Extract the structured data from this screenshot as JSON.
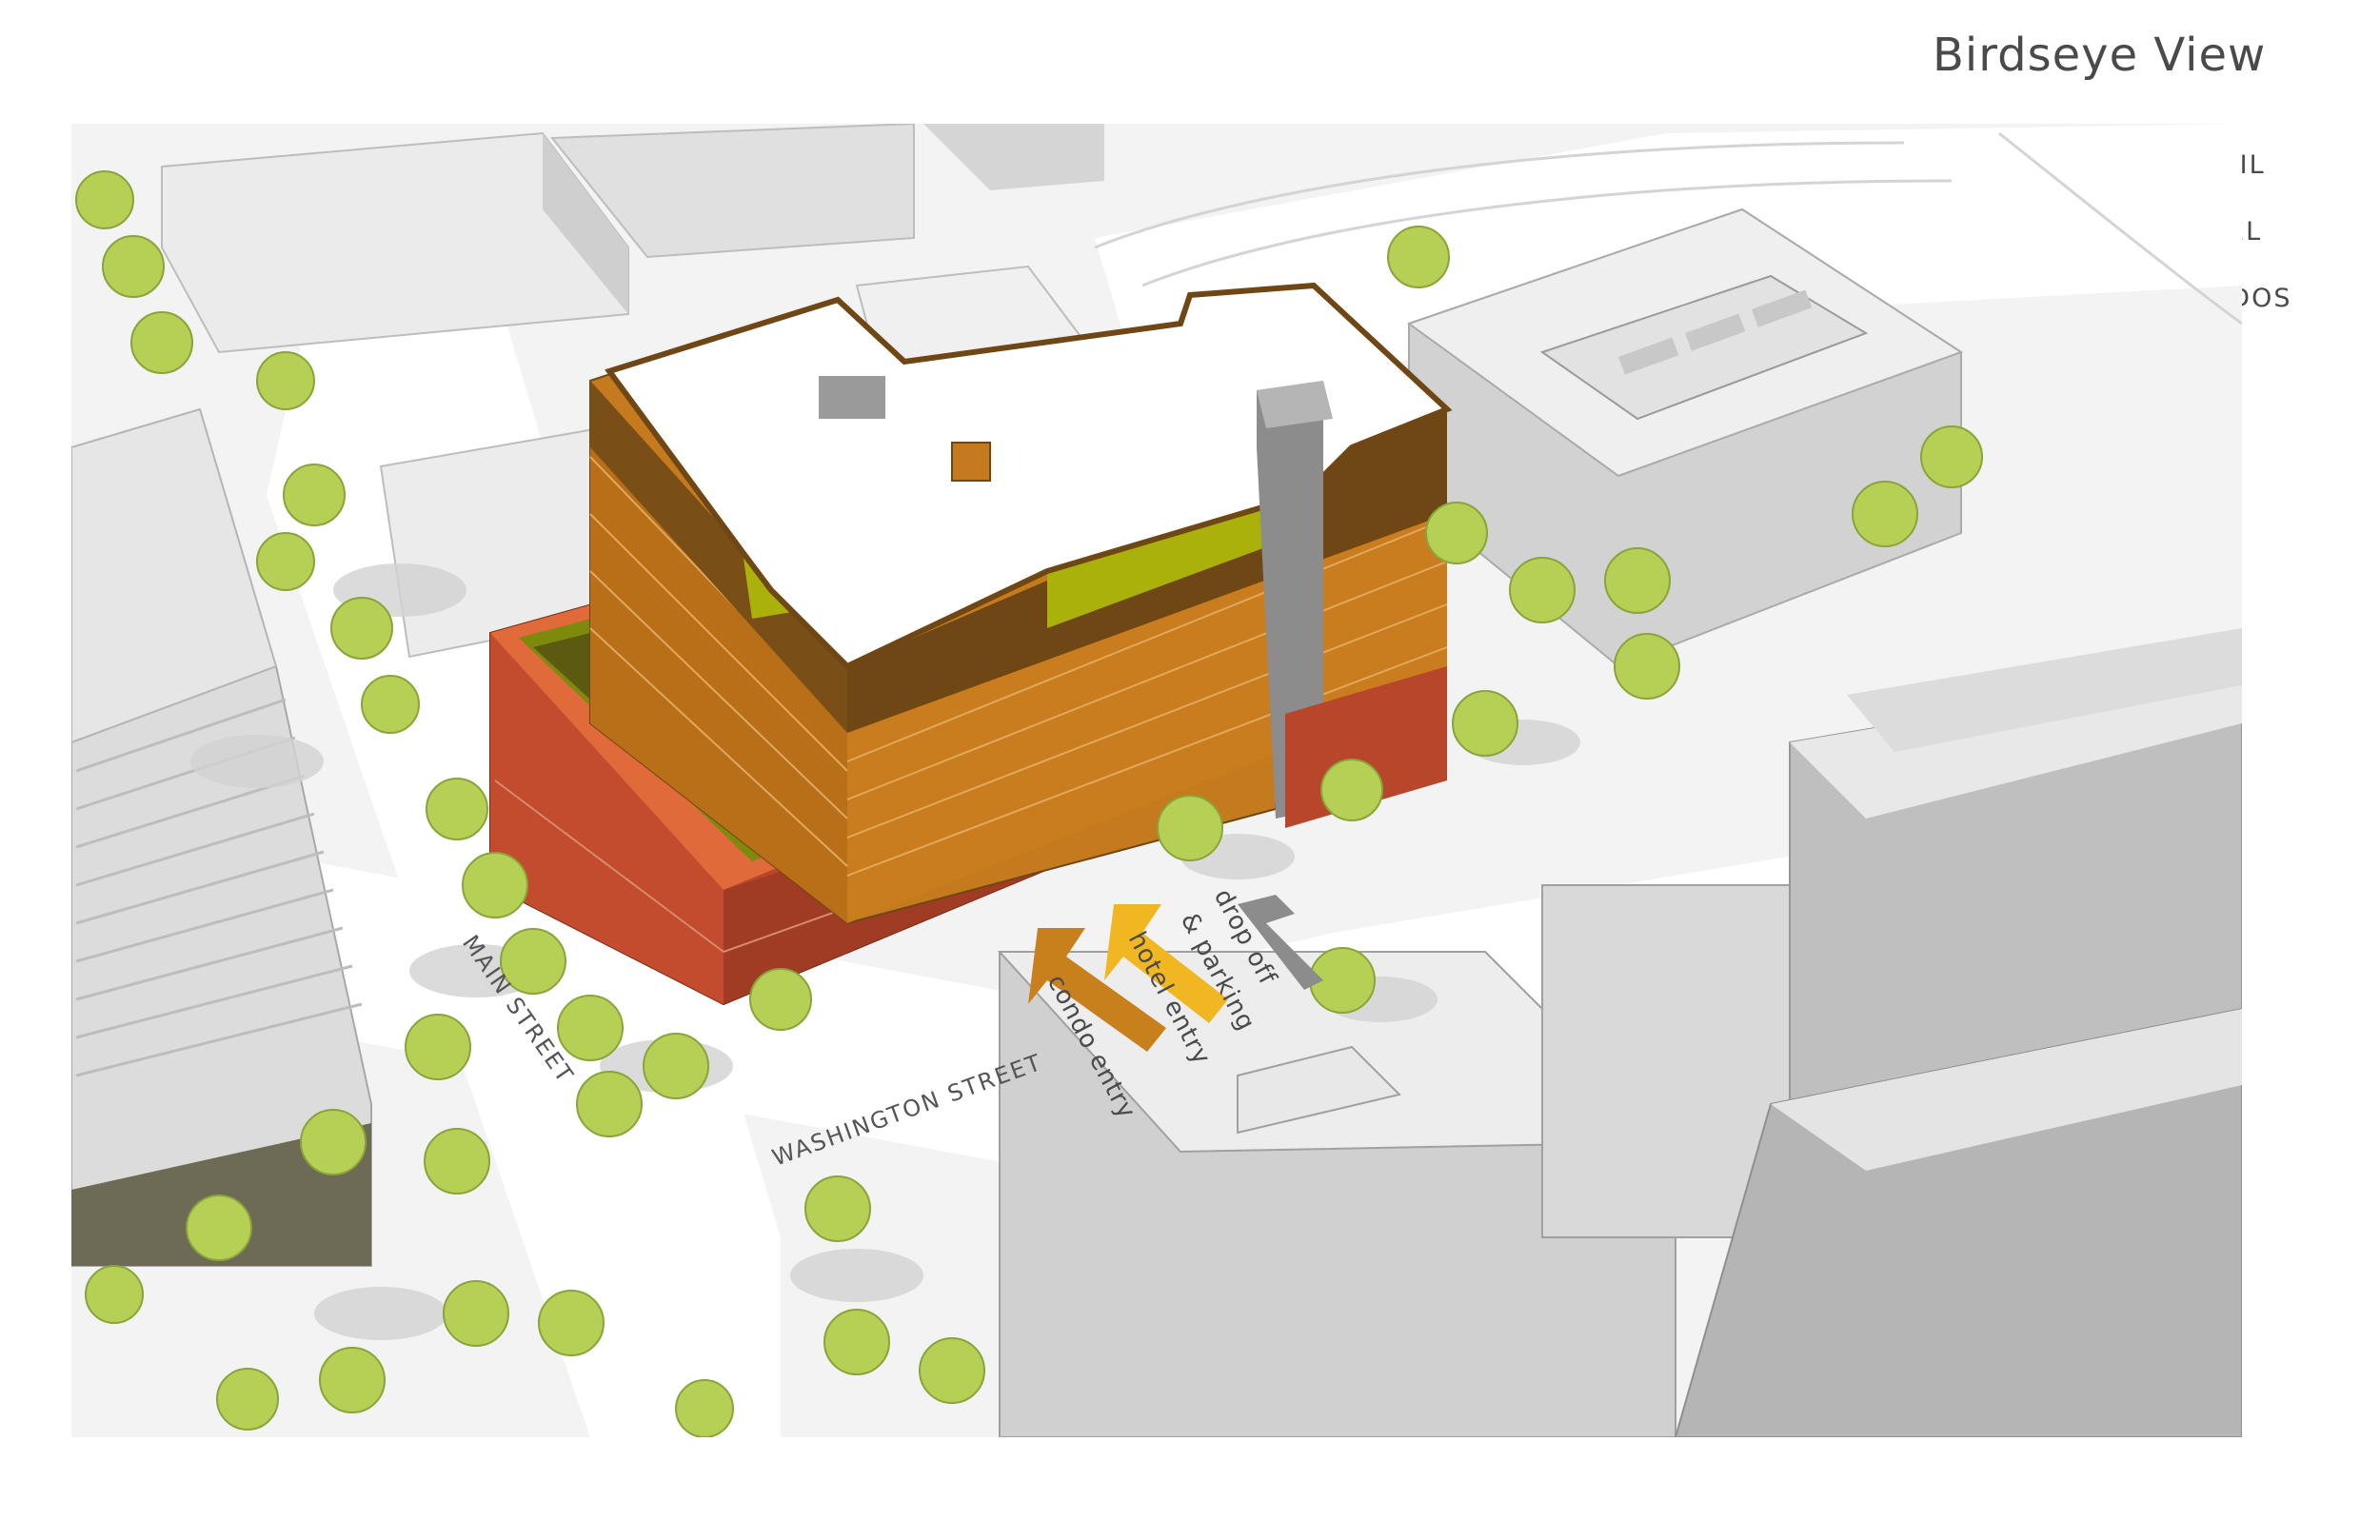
{
  "title": "Birdseye View",
  "legend": [
    {
      "label": "RETAIL",
      "color": "#F58A4F"
    },
    {
      "label": "HOTEL",
      "color": "#FDE03A"
    },
    {
      "label": "CONDOS",
      "color": "#C7801B"
    }
  ],
  "streets": {
    "main": "MAIN STREET",
    "washington": "WASHINGTON STREET"
  },
  "entries": {
    "condo": "condo entry",
    "hotel": "hotel entry",
    "dropoff_line1": "drop off",
    "dropoff_line2": "& parking"
  },
  "colors": {
    "retail_facade": "#B8462A",
    "condo_facade": "#C67A1E",
    "condo_band": "#6E4714",
    "hotel_terrace": "#A9B10A",
    "context_building": "#D9D9D9",
    "tree": "#B6CF55"
  }
}
